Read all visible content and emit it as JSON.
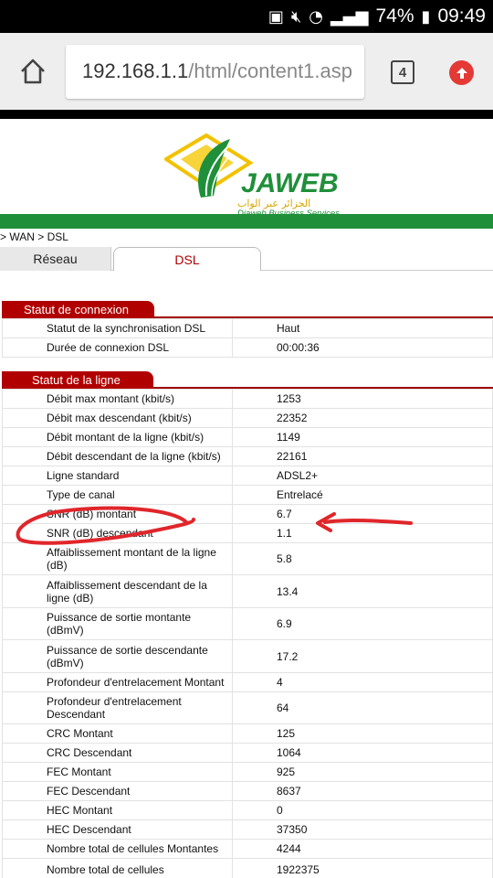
{
  "status_bar": {
    "battery_percent": "74%",
    "time": "09:49"
  },
  "browser": {
    "url_host": "192.168.1.1",
    "url_path": "/html/content1.asp",
    "tab_count": "4"
  },
  "header": {
    "logo_title": "JAWEB",
    "logo_arabic": "الجزائر عبر الواب",
    "logo_subtitle": "Djaweb Business Services",
    "colors": {
      "green": "#1f8f3a",
      "red": "#b10000",
      "yellow": "#f2c200"
    }
  },
  "breadcrumb": "> WAN > DSL",
  "tabs": [
    {
      "label": "Réseau",
      "active": false
    },
    {
      "label": "DSL",
      "active": true
    }
  ],
  "sections": {
    "connexion": {
      "title": "Statut de connexion",
      "rows": [
        {
          "label": "Statut de la synchronisation DSL",
          "value": "Haut"
        },
        {
          "label": "Durée de connexion DSL",
          "value": "00:00:36"
        }
      ]
    },
    "ligne": {
      "title": "Statut de la ligne",
      "rows": [
        {
          "label": "Débit max montant (kbit/s)",
          "value": "1253"
        },
        {
          "label": "Débit max descendant (kbit/s)",
          "value": "22352"
        },
        {
          "label": "Débit montant de la ligne (kbit/s)",
          "value": "1149"
        },
        {
          "label": "Débit descendant de la ligne (kbit/s)",
          "value": "22161"
        },
        {
          "label": "Ligne standard",
          "value": "ADSL2+"
        },
        {
          "label": "Type de canal",
          "value": "Entrelacé"
        },
        {
          "label": "SNR (dB) montant",
          "value": "6.7"
        },
        {
          "label": "SNR (dB) descendant",
          "value": "1.1"
        },
        {
          "label": "Affaiblissement montant de la ligne (dB)",
          "value": "5.8"
        },
        {
          "label": "Affaiblissement descendant de la ligne (dB)",
          "value": "13.4"
        },
        {
          "label": "Puissance de sortie montante (dBmV)",
          "value": "6.9"
        },
        {
          "label": "Puissance de sortie descendante (dBmV)",
          "value": "17.2"
        },
        {
          "label": "Profondeur d'entrelacement Montant",
          "value": "4"
        },
        {
          "label": "Profondeur d'entrelacement Descendant",
          "value": "64"
        },
        {
          "label": "CRC Montant",
          "value": "125"
        },
        {
          "label": "CRC Descendant",
          "value": "1064"
        },
        {
          "label": "FEC Montant",
          "value": "925"
        },
        {
          "label": "FEC Descendant",
          "value": "8637"
        },
        {
          "label": "HEC Montant",
          "value": "0"
        },
        {
          "label": "HEC Descendant",
          "value": "37350"
        },
        {
          "label": "Nombre total de cellules Montantes",
          "value": "4244"
        },
        {
          "label": "Nombre total de cellules",
          "value": "1922375"
        }
      ]
    }
  },
  "annotation_color": "#e0262b"
}
